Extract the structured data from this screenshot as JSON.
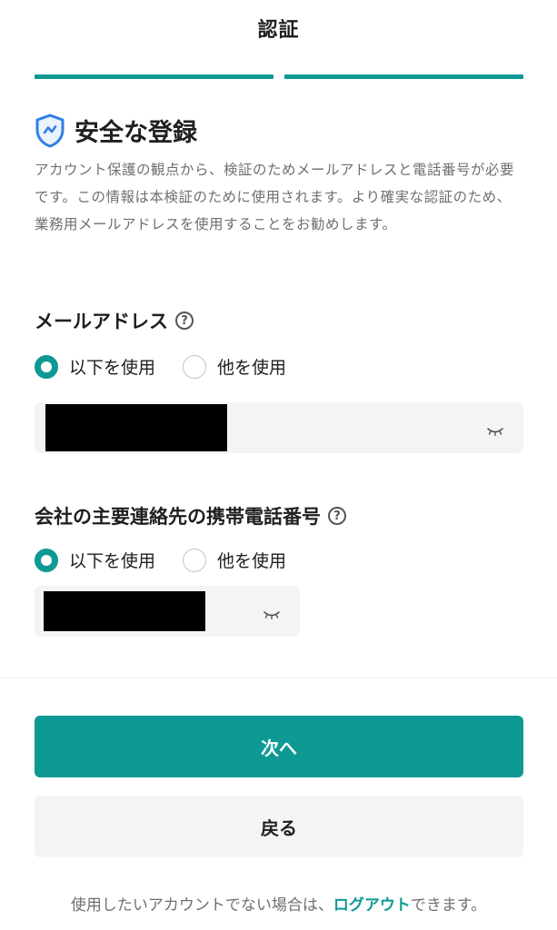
{
  "header": {
    "title": "認証"
  },
  "progress": {
    "steps_total": 2,
    "steps_completed": 2,
    "color": "#0e9994"
  },
  "section": {
    "title": "安全な登録",
    "icon": "shield-icon",
    "description": "アカウント保護の観点から、検証のためメールアドレスと電話番号が必要です。この情報は本検証のために使用されます。より確実な認証のため、業務用メールアドレスを使用することをお勧めします。"
  },
  "email": {
    "label": "メールアドレス",
    "help_icon": "?",
    "options": [
      {
        "label": "以下を使用",
        "checked": true
      },
      {
        "label": "他を使用",
        "checked": false
      }
    ],
    "value_redacted": true
  },
  "phone": {
    "label": "会社の主要連絡先の携帯電話番号",
    "help_icon": "?",
    "options": [
      {
        "label": "以下を使用",
        "checked": true
      },
      {
        "label": "他を使用",
        "checked": false
      }
    ],
    "value_redacted": true
  },
  "actions": {
    "next_label": "次へ",
    "back_label": "戻る"
  },
  "footer": {
    "text_before": "使用したいアカウントでない場合は、",
    "link_label": "ログアウト",
    "text_after": "できます。"
  },
  "colors": {
    "accent": "#0e9994",
    "shield_blue": "#2f7fe6",
    "muted_text": "#6f6f6f",
    "input_bg": "#f4f4f4"
  }
}
